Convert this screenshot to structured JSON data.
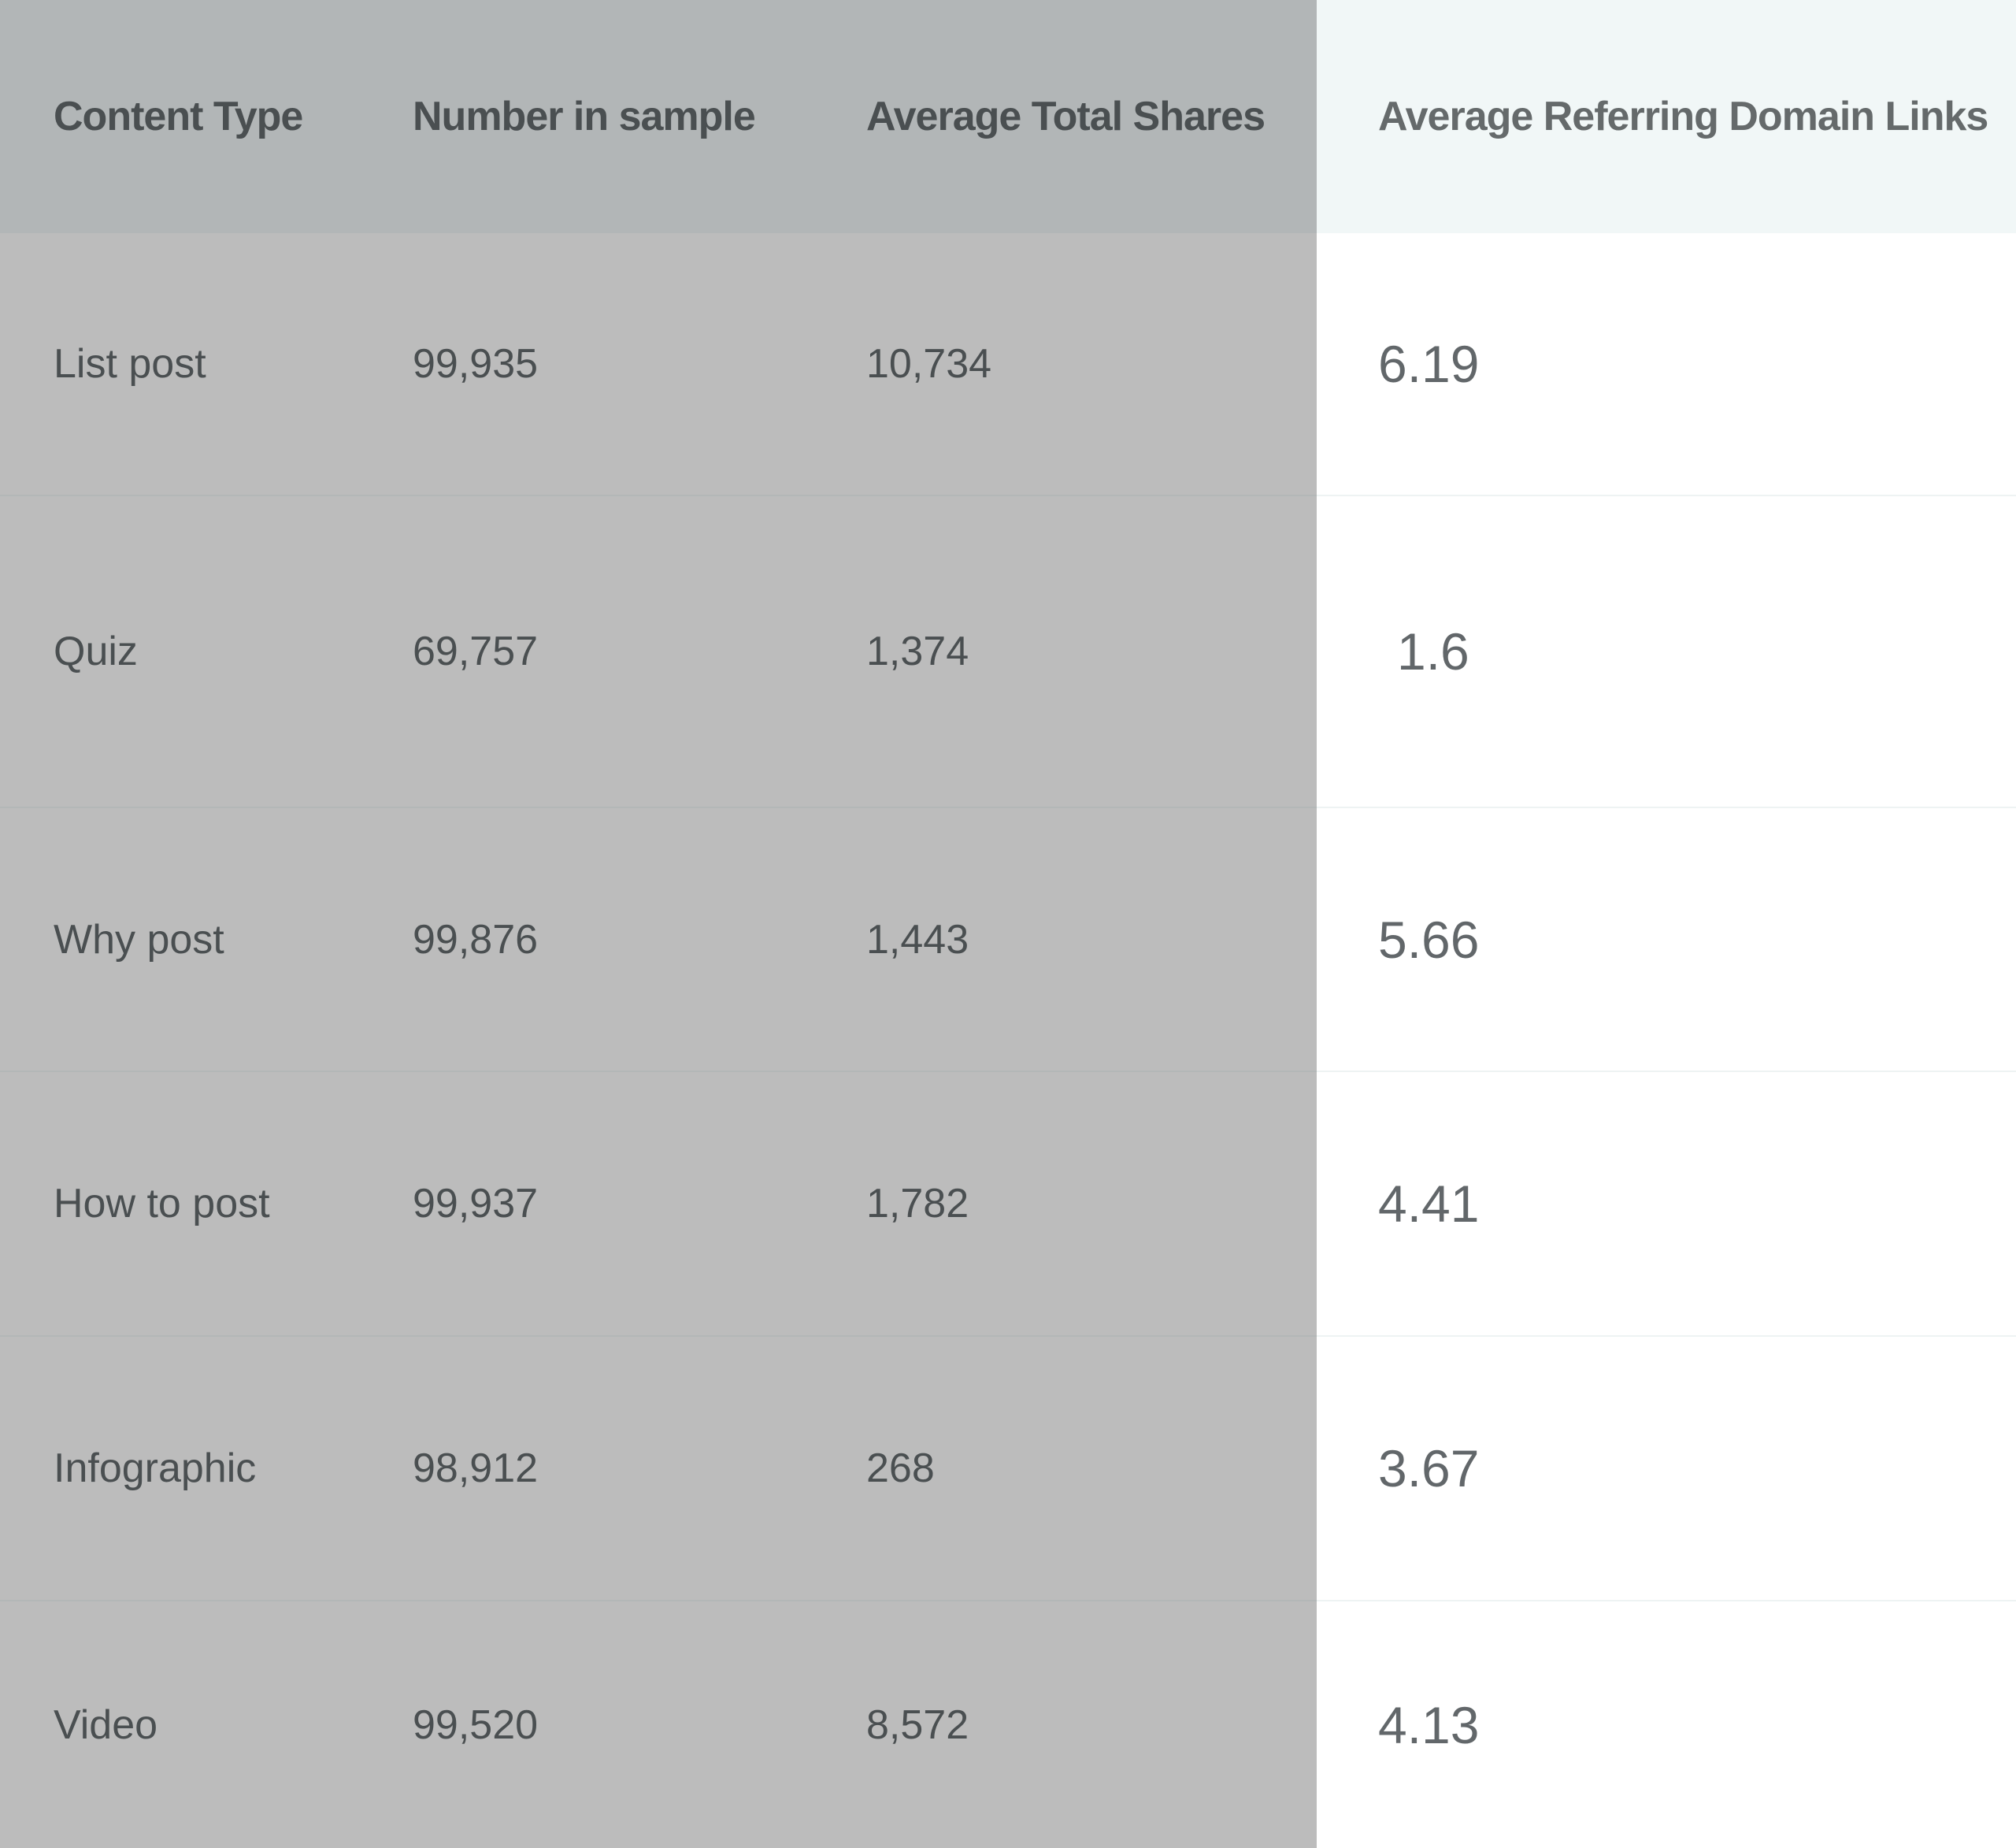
{
  "table": {
    "headers": [
      "Content Type",
      "Number in sample",
      "Average Total Shares",
      "Average Referring Domain Links"
    ],
    "rows": [
      [
        "List post",
        "99,935",
        "10,734",
        "6.19"
      ],
      [
        "Quiz",
        "69,757",
        "1,374",
        "1.6"
      ],
      [
        "Why post",
        "99,876",
        "1,443",
        "5.66"
      ],
      [
        "How to post",
        "99,937",
        "1,782",
        "4.41"
      ],
      [
        "Infographic",
        "98,912",
        "268",
        "3.67"
      ],
      [
        "Video",
        "99,520",
        "8,572",
        "4.13"
      ]
    ]
  },
  "colors": {
    "shaded_header": "#b2b6b7",
    "shaded_body": "#bcbcbc",
    "highlight_header": "#f1f7f7",
    "highlight_body": "#ffffff",
    "text": "#4a4f51"
  }
}
